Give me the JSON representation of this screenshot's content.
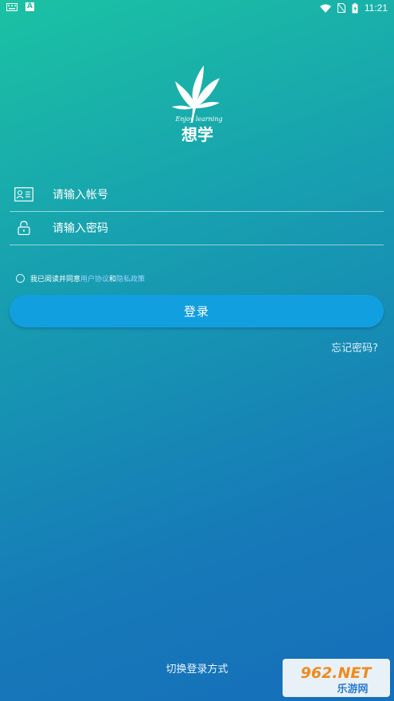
{
  "status_bar": {
    "time": "11:21",
    "notif_letter": "A"
  },
  "logo": {
    "tagline": "Enjoy learning",
    "brand": "想学"
  },
  "form": {
    "account_placeholder": "请输入帐号",
    "password_placeholder": "请输入密码"
  },
  "agreement": {
    "prefix": "我已阅读并同意",
    "user_agreement": "用户协议",
    "and": "和",
    "privacy_policy": "隐私政策"
  },
  "login_button": "登录",
  "forgot_password": "忘记密码?",
  "switch_login": "切换登录方式",
  "watermark": {
    "top": "962.NET",
    "bottom": "乐游网"
  },
  "colors": {
    "button": "#129fdf",
    "link": "#9fd3ff"
  }
}
